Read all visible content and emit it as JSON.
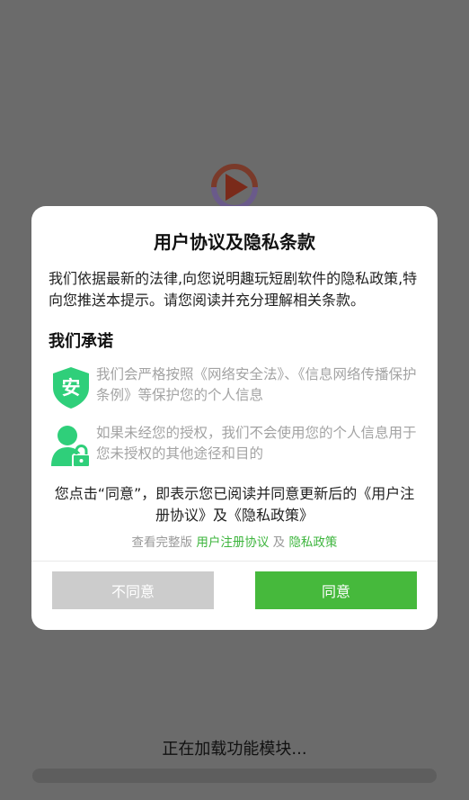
{
  "dialog": {
    "title": "用户协议及隐私条款",
    "intro": "我们依据最新的法律,向您说明趣玩短剧软件的隐私政策,特向您推送本提示。请您阅读并充分理解相关条款。",
    "section_title": "我们承诺",
    "promises": [
      {
        "icon": "shield-icon",
        "icon_text": "安",
        "text": "我们会严格按照《网络安全法》、《信息网络传播保护条例》等保护您的个人信息"
      },
      {
        "icon": "user-lock-icon",
        "text": "如果未经您的授权，我们不会使用您的个人信息用于您未授权的其他途径和目的"
      }
    ],
    "consent_text": "您点击“同意”，即表示您已阅读并同意更新后的《用户注册协议》及《隐私政策》",
    "links": {
      "prefix": "查看完整版",
      "user_agreement": "用户注册协议",
      "and": "及",
      "privacy_policy": "隐私政策"
    },
    "buttons": {
      "disagree": "不同意",
      "agree": "同意"
    }
  },
  "loading": {
    "text": "正在加载功能模块...",
    "progress": 0
  },
  "colors": {
    "accent": "#46b93c",
    "link": "#3db53d",
    "disabled_button": "#cccccc",
    "overlay": "#6b6b6b"
  }
}
